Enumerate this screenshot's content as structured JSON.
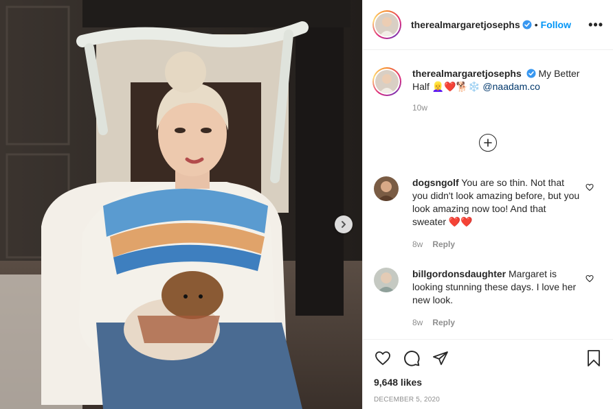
{
  "post": {
    "username": "therealmargaretjosephs",
    "follow_label": "Follow",
    "dot": "•",
    "more_label": "•••"
  },
  "caption": {
    "username": "therealmargaretjosephs",
    "text_before": "My Better Half",
    "emojis": "👱‍♀️❤️🐕❄️",
    "mention": "@naadam.co",
    "time": "10w"
  },
  "comments": [
    {
      "username": "dogsngolf",
      "text": "You are so thin. Not that you didn't look amazing before, but you look amazing now too! And that sweater",
      "emojis": "❤️❤️",
      "time": "8w",
      "reply_label": "Reply"
    },
    {
      "username": "billgordonsdaughter",
      "text": "Margaret is looking stunning these days. I love her new look.",
      "emojis": "",
      "time": "8w",
      "reply_label": "Reply"
    }
  ],
  "footer": {
    "likes": "9,648 likes",
    "date": "DECEMBER 5, 2020"
  },
  "colors": {
    "accent": "#0095f6",
    "heart_red": "#ed1c24",
    "muted": "#8e8e8e"
  },
  "icons": {
    "verified": "verified-badge-icon",
    "like": "heart-icon",
    "comment": "comment-bubble-icon",
    "share": "paper-plane-icon",
    "save": "bookmark-icon",
    "load_more": "plus-circle-icon",
    "next": "chevron-right-icon"
  }
}
